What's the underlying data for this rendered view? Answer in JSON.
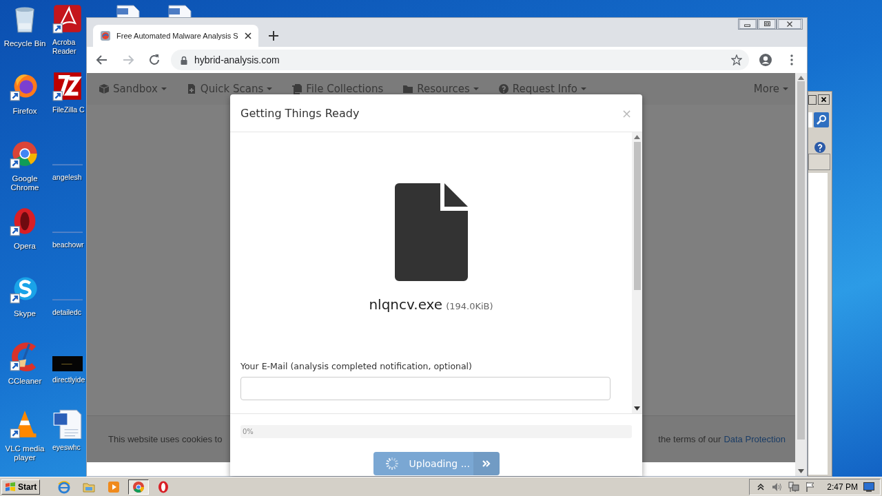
{
  "desktop": {
    "icon_columns": [
      {
        "icons": [
          {
            "kind": "bin",
            "label": "Recycle Bin",
            "shortcut": false
          },
          {
            "kind": "fox",
            "label": "Firefox",
            "shortcut": true
          },
          {
            "kind": "globe",
            "label": "Google Chrome",
            "shortcut": true
          },
          {
            "kind": "ring",
            "label": "Opera",
            "shortcut": true
          },
          {
            "kind": "wave",
            "label": "Skype",
            "shortcut": true
          },
          {
            "kind": "arc",
            "label": "CCleaner",
            "shortcut": true
          },
          {
            "kind": "cone",
            "label": "VLC media player",
            "shortcut": true
          }
        ]
      },
      {
        "icons": [
          {
            "kind": "pdf",
            "label_lines": [
              "Acroba",
              "Reader"
            ],
            "shortcut": true
          },
          {
            "kind": "ftp",
            "label_lines": [
              "FileZilla C"
            ],
            "shortcut": true
          },
          {
            "kind": "blank",
            "label_lines": [
              "angelesh"
            ],
            "shortcut": false
          },
          {
            "kind": "blank",
            "label_lines": [
              "beachowr"
            ],
            "shortcut": false
          },
          {
            "kind": "blank",
            "label_lines": [
              "detailedc"
            ],
            "shortcut": false
          },
          {
            "kind": "dark",
            "label_lines": [
              "directlyide"
            ],
            "shortcut": false
          },
          {
            "kind": "doc",
            "label_lines": [
              "eyeswhc"
            ],
            "shortcut": false
          }
        ]
      }
    ],
    "partly_hidden_icons": [
      {
        "kind": "sheet"
      },
      {
        "kind": "sheet"
      }
    ]
  },
  "browser": {
    "tabs": [
      {
        "title": "Free Automated Malware Analysis S",
        "selected": true
      }
    ],
    "toolbar": {
      "url": "hybrid-analysis.com",
      "forward_disabled": true
    },
    "nav": [
      {
        "kind": "cube",
        "label": "Sandbox",
        "dropdown": true
      },
      {
        "kind": "file",
        "label": "Quick Scans",
        "dropdown": true
      },
      {
        "kind": "files",
        "label": "File Collections",
        "dropdown": false
      },
      {
        "kind": "folder",
        "label": "Resources",
        "dropdown": true
      },
      {
        "kind": "help",
        "label": "Request Info",
        "dropdown": true
      }
    ],
    "nav_more": {
      "label": "More",
      "dropdown": true
    },
    "cookie_bar": {
      "text_start": "This website uses cookies to",
      "text_end": "the terms of our",
      "link": "Data Protection"
    },
    "modal": {
      "title": "Getting Things Ready",
      "close": "×",
      "file": {
        "name": "nlqncv.exe",
        "size": "(194.0KiB)"
      },
      "email": {
        "label": "Your E-Mail (analysis completed notification, optional)"
      },
      "progress": {
        "level": 0,
        "label": "0%"
      },
      "button": {
        "label": "Uploading ...",
        "disabled": true
      }
    }
  },
  "taskbar": {
    "start": "Start",
    "items": [
      {
        "kind": "ie",
        "selected": false
      },
      {
        "kind": "folder",
        "selected": false
      },
      {
        "kind": "media",
        "selected": false
      },
      {
        "kind": "chrome",
        "selected": true
      },
      {
        "kind": "opera",
        "selected": false
      }
    ],
    "tray": {
      "time": "2:47 PM"
    }
  }
}
